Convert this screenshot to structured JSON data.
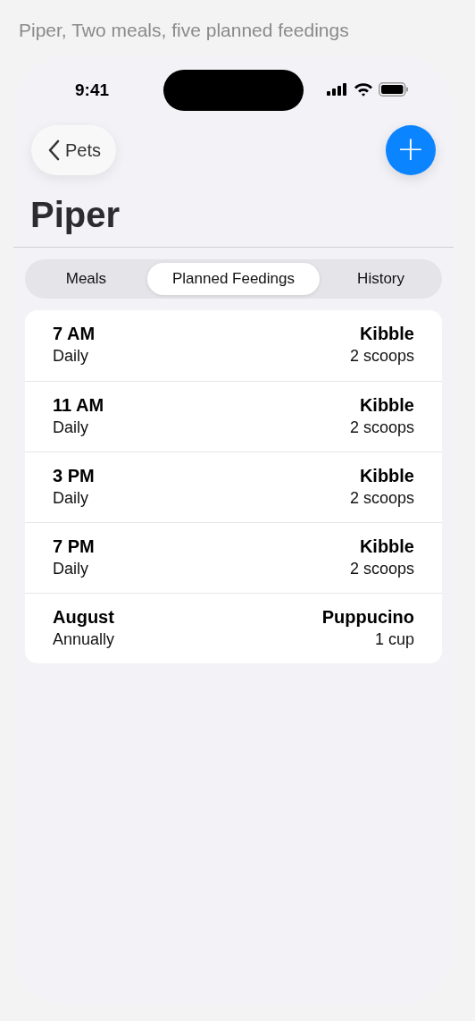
{
  "caption": "Piper, Two meals, five planned feedings",
  "status_bar": {
    "time": "9:41"
  },
  "nav": {
    "back_label": "Pets",
    "add_icon": "+"
  },
  "title": "Piper",
  "tabs": [
    {
      "label": "Meals",
      "selected": false
    },
    {
      "label": "Planned Feedings",
      "selected": true
    },
    {
      "label": "History",
      "selected": false
    }
  ],
  "feedings": [
    {
      "time": "7 AM",
      "repeat": "Daily",
      "food": "Kibble",
      "amount": "2 scoops"
    },
    {
      "time": "11 AM",
      "repeat": "Daily",
      "food": "Kibble",
      "amount": "2 scoops"
    },
    {
      "time": "3 PM",
      "repeat": "Daily",
      "food": "Kibble",
      "amount": "2 scoops"
    },
    {
      "time": "7 PM",
      "repeat": "Daily",
      "food": "Kibble",
      "amount": "2 scoops"
    },
    {
      "time": "August",
      "repeat": "Annually",
      "food": "Puppucino",
      "amount": "1 cup"
    }
  ]
}
